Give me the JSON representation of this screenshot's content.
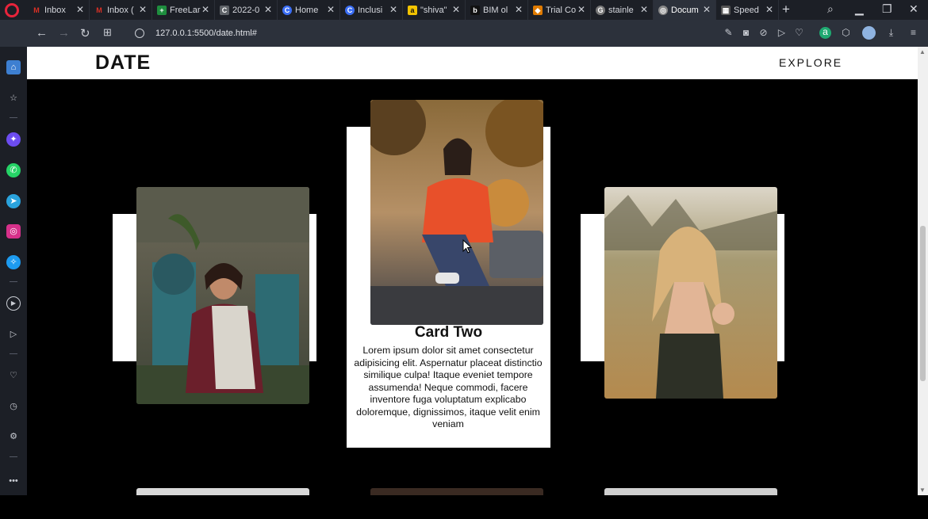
{
  "browser": {
    "tabs": [
      {
        "label": "Inbox",
        "color": "#d93025",
        "glyph": "M"
      },
      {
        "label": "Inbox (",
        "color": "#d93025",
        "glyph": "M"
      },
      {
        "label": "FreeLar",
        "color": "#1e8e3e",
        "glyph": "+"
      },
      {
        "label": "2022-0",
        "color": "#5f6368",
        "glyph": "C"
      },
      {
        "label": "Home",
        "color": "#3b6ef5",
        "glyph": "C"
      },
      {
        "label": "Inclusi",
        "color": "#3b6ef5",
        "glyph": "C"
      },
      {
        "label": "\"shiva\"",
        "color": "#f2c300",
        "glyph": "a"
      },
      {
        "label": "BIM ol",
        "color": "#111111",
        "glyph": "b"
      },
      {
        "label": "Trial Co",
        "color": "#e07b00",
        "glyph": "◆"
      },
      {
        "label": "stainle",
        "color": "#777777",
        "glyph": "G"
      },
      {
        "label": "Docum",
        "color": "#888888",
        "glyph": "◎"
      },
      {
        "label": "Speed",
        "color": "#555555",
        "glyph": "▦"
      }
    ],
    "url": "127.0.0.1:5500/date.html#"
  },
  "site": {
    "logo": "DATE",
    "nav_explore": "EXPLORE"
  },
  "featured_card": {
    "title": "Card Two",
    "text": "Lorem ipsum dolor sit amet consectetur adipisicing elit. Aspernatur placeat distinctio similique culpa! Itaque eveniet tempore assumenda! Neque commodi, facere inventore fuga voluptatum explicabo doloremque, dignissimos, itaque velit enim veniam"
  },
  "colors": {
    "page_bg": "#000000",
    "header_bg": "#ffffff",
    "card_bg": "#ffffff",
    "browser_chrome": "#1c1f26"
  }
}
